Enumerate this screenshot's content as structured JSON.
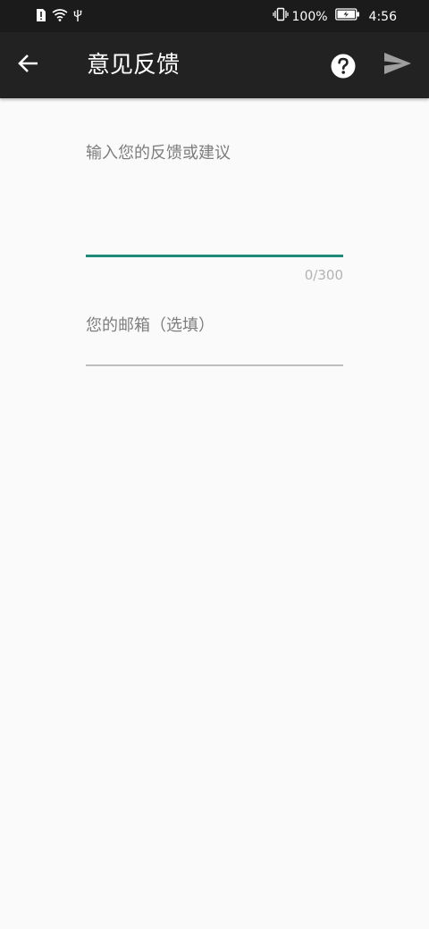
{
  "status_bar": {
    "battery_percent": "100%",
    "time": "4:56",
    "icons": [
      "sim-alert-icon",
      "wifi-icon",
      "usb-icon",
      "vibrate-icon",
      "battery-charging-icon"
    ]
  },
  "app_bar": {
    "title": "意见反馈",
    "back_icon": "arrow-left-icon",
    "help_icon": "help-circle-icon",
    "send_icon": "send-icon"
  },
  "form": {
    "feedback": {
      "placeholder": "输入您的反馈或建议",
      "value": "",
      "counter": "0/300",
      "accent_color": "#1e8a7a"
    },
    "email": {
      "placeholder": "您的邮箱（选填）",
      "value": ""
    }
  }
}
